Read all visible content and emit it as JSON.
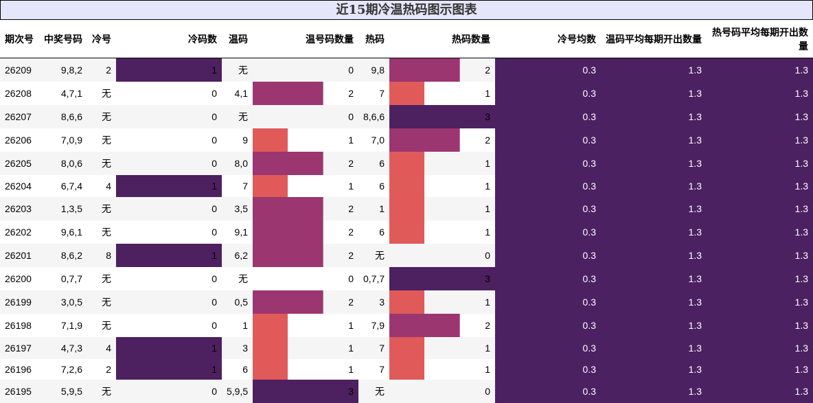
{
  "title": "近15期冷温热码图示图表",
  "headers": {
    "period": "期次号",
    "winning": "中奖号码",
    "cold": "冷号",
    "cold_count": "冷码数",
    "warm": "温码",
    "warm_count": "温号码数量",
    "hot": "热码",
    "hot_count": "热码数量",
    "cold_avg": "冷号均数",
    "warm_avg": "温码平均每期开出数量",
    "hot_avg": "热号码平均每期开出数量"
  },
  "colors": {
    "c1": "#4d2060",
    "c2": "#9b3670",
    "c3": "#e05a5a",
    "avg_bg": "#4c2162"
  },
  "rows": [
    {
      "period": "26209",
      "winning": "9,8,2",
      "cold": "2",
      "cold_count": "1",
      "warm": "无",
      "warm_count": "0",
      "hot": "9,8",
      "hot_count": "2",
      "cold_avg": "0.3",
      "warm_avg": "1.3",
      "hot_avg": "1.3"
    },
    {
      "period": "26208",
      "winning": "4,7,1",
      "cold": "无",
      "cold_count": "0",
      "warm": "4,1",
      "warm_count": "2",
      "hot": "7",
      "hot_count": "1",
      "cold_avg": "0.3",
      "warm_avg": "1.3",
      "hot_avg": "1.3"
    },
    {
      "period": "26207",
      "winning": "8,6,6",
      "cold": "无",
      "cold_count": "0",
      "warm": "无",
      "warm_count": "0",
      "hot": "8,6,6",
      "hot_count": "3",
      "cold_avg": "0.3",
      "warm_avg": "1.3",
      "hot_avg": "1.3"
    },
    {
      "period": "26206",
      "winning": "7,0,9",
      "cold": "无",
      "cold_count": "0",
      "warm": "9",
      "warm_count": "1",
      "hot": "7,0",
      "hot_count": "2",
      "cold_avg": "0.3",
      "warm_avg": "1.3",
      "hot_avg": "1.3"
    },
    {
      "period": "26205",
      "winning": "8,0,6",
      "cold": "无",
      "cold_count": "0",
      "warm": "8,0",
      "warm_count": "2",
      "hot": "6",
      "hot_count": "1",
      "cold_avg": "0.3",
      "warm_avg": "1.3",
      "hot_avg": "1.3"
    },
    {
      "period": "26204",
      "winning": "6,7,4",
      "cold": "4",
      "cold_count": "1",
      "warm": "7",
      "warm_count": "1",
      "hot": "6",
      "hot_count": "1",
      "cold_avg": "0.3",
      "warm_avg": "1.3",
      "hot_avg": "1.3"
    },
    {
      "period": "26203",
      "winning": "1,3,5",
      "cold": "无",
      "cold_count": "0",
      "warm": "3,5",
      "warm_count": "2",
      "hot": "1",
      "hot_count": "1",
      "cold_avg": "0.3",
      "warm_avg": "1.3",
      "hot_avg": "1.3"
    },
    {
      "period": "26202",
      "winning": "9,6,1",
      "cold": "无",
      "cold_count": "0",
      "warm": "9,1",
      "warm_count": "2",
      "hot": "6",
      "hot_count": "1",
      "cold_avg": "0.3",
      "warm_avg": "1.3",
      "hot_avg": "1.3"
    },
    {
      "period": "26201",
      "winning": "8,6,2",
      "cold": "8",
      "cold_count": "1",
      "warm": "6,2",
      "warm_count": "2",
      "hot": "无",
      "hot_count": "0",
      "cold_avg": "0.3",
      "warm_avg": "1.3",
      "hot_avg": "1.3"
    },
    {
      "period": "26200",
      "winning": "0,7,7",
      "cold": "无",
      "cold_count": "0",
      "warm": "无",
      "warm_count": "0",
      "hot": "0,7,7",
      "hot_count": "3",
      "cold_avg": "0.3",
      "warm_avg": "1.3",
      "hot_avg": "1.3"
    },
    {
      "period": "26199",
      "winning": "3,0,5",
      "cold": "无",
      "cold_count": "0",
      "warm": "0,5",
      "warm_count": "2",
      "hot": "3",
      "hot_count": "1",
      "cold_avg": "0.3",
      "warm_avg": "1.3",
      "hot_avg": "1.3"
    },
    {
      "period": "26198",
      "winning": "7,1,9",
      "cold": "无",
      "cold_count": "0",
      "warm": "1",
      "warm_count": "1",
      "hot": "7,9",
      "hot_count": "2",
      "cold_avg": "0.3",
      "warm_avg": "1.3",
      "hot_avg": "1.3"
    },
    {
      "period": "26197",
      "winning": "4,7,3",
      "cold": "4",
      "cold_count": "1",
      "warm": "3",
      "warm_count": "1",
      "hot": "7",
      "hot_count": "1",
      "cold_avg": "0.3",
      "warm_avg": "1.3",
      "hot_avg": "1.3"
    },
    {
      "period": "26196",
      "winning": "7,2,6",
      "cold": "2",
      "cold_count": "1",
      "warm": "6",
      "warm_count": "1",
      "hot": "7",
      "hot_count": "1",
      "cold_avg": "0.3",
      "warm_avg": "1.3",
      "hot_avg": "1.3"
    },
    {
      "period": "26195",
      "winning": "5,9,5",
      "cold": "无",
      "cold_count": "0",
      "warm": "5,9,5",
      "warm_count": "3",
      "hot": "无",
      "hot_count": "0",
      "cold_avg": "0.3",
      "warm_avg": "1.3",
      "hot_avg": "1.3"
    }
  ]
}
